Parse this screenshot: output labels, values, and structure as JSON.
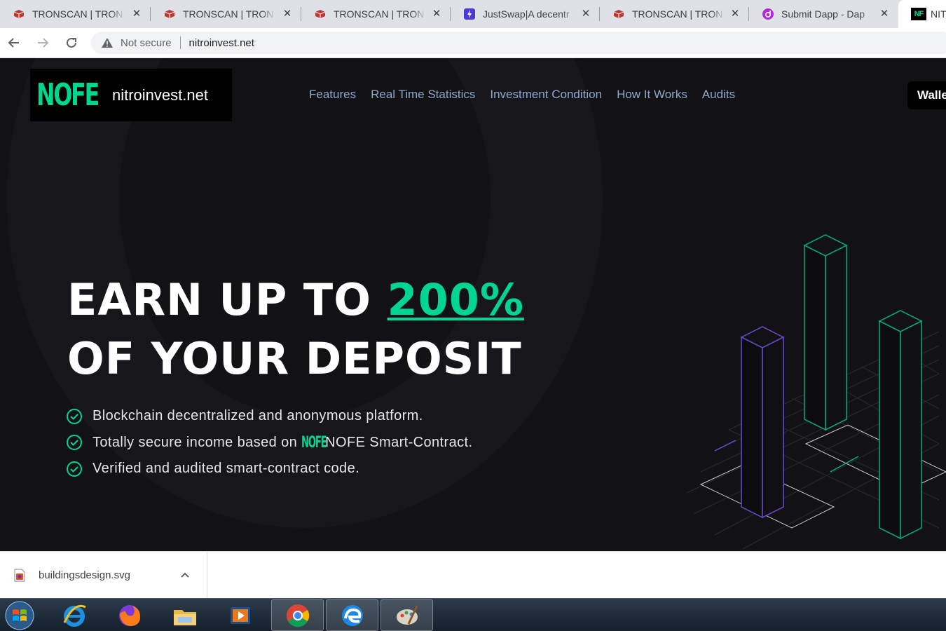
{
  "browser": {
    "tabs": [
      {
        "title": "TRONSCAN | TRON",
        "icon": "tronscan-icon"
      },
      {
        "title": "TRONSCAN | TRON",
        "icon": "tronscan-icon"
      },
      {
        "title": "TRONSCAN | TRON",
        "icon": "tronscan-icon"
      },
      {
        "title": "JustSwap|A decentr",
        "icon": "justswap-icon"
      },
      {
        "title": "TRONSCAN | TRON",
        "icon": "tronscan-icon"
      },
      {
        "title": "Submit Dapp - Dap",
        "icon": "dapp-icon"
      },
      {
        "title": "NIT",
        "icon": "nofe-icon",
        "active": true
      }
    ],
    "security_label": "Not secure",
    "url": "nitroinvest.net"
  },
  "site": {
    "logo_mark": "NOFE",
    "logo_text": "nitroinvest.net",
    "nav": [
      "Features",
      "Real Time Statistics",
      "Investment Condition",
      "How It Works",
      "Audits"
    ],
    "wallet_label": "Walle",
    "hero": {
      "line1_prefix": "EARN UP TO ",
      "line1_accent": "200%",
      "line2": "OF YOUR DEPOSIT"
    },
    "features": {
      "item1": "Blockchain decentralized and anonymous platform.",
      "item2_prefix": "Totally secure income based on",
      "item2_logo": "NOFE",
      "item2_suffix": "NOFE Smart-Contract.",
      "item3": "Verified and audited smart-contract code."
    },
    "colors": {
      "accent": "#00d68f",
      "background": "#121215",
      "nav": "#8fa7cc"
    }
  },
  "download_shelf": {
    "file_name": "buildingsdesign.svg"
  },
  "taskbar": {
    "items": [
      "start-icon",
      "internet-explorer-icon",
      "firefox-icon",
      "file-explorer-icon",
      "media-player-icon",
      "chrome-icon",
      "edge-icon",
      "paint-icon"
    ]
  }
}
